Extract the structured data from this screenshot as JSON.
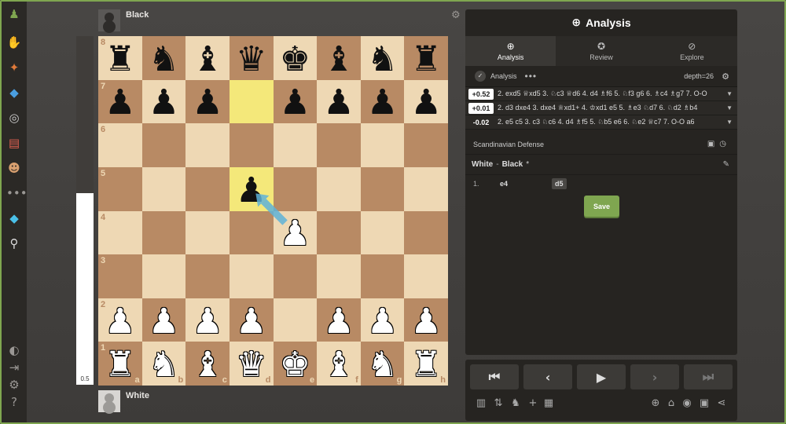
{
  "sidebar": {
    "icons": [
      "pawn-logo-icon",
      "play-icon",
      "puzzle-icon",
      "learn-icon",
      "watch-icon",
      "news-icon",
      "social-icon",
      "more-icon",
      "diamond-icon",
      "search-icon",
      "theme-icon",
      "login-icon",
      "settings-icon",
      "help-icon"
    ]
  },
  "players": {
    "top": {
      "name": "Black"
    },
    "bottom": {
      "name": "White"
    }
  },
  "eval_bar": {
    "text": "0.5",
    "white_fraction": 0.55
  },
  "board": {
    "light_color": "#eed8b4",
    "dark_color": "#b88a64",
    "highlight_color": "#f4e87a",
    "ranks": [
      "8",
      "7",
      "6",
      "5",
      "4",
      "3",
      "2",
      "1"
    ],
    "files": [
      "a",
      "b",
      "c",
      "d",
      "e",
      "f",
      "g",
      "h"
    ],
    "position": [
      [
        "br",
        "bn",
        "bb",
        "bq",
        "bk",
        "bb",
        "bn",
        "br"
      ],
      [
        "bp",
        "bp",
        "bp",
        "",
        "bp",
        "bp",
        "bp",
        "bp"
      ],
      [
        "",
        "",
        "",
        "",
        "",
        "",
        "",
        ""
      ],
      [
        "",
        "",
        "",
        "bp",
        "",
        "",
        "",
        ""
      ],
      [
        "",
        "",
        "",
        "",
        "wp",
        "",
        "",
        ""
      ],
      [
        "",
        "",
        "",
        "",
        "",
        "",
        "",
        ""
      ],
      [
        "wp",
        "wp",
        "wp",
        "wp",
        "",
        "wp",
        "wp",
        "wp"
      ],
      [
        "wr",
        "wn",
        "wb",
        "wq",
        "wk",
        "wb",
        "wn",
        "wr"
      ]
    ],
    "highlighted_squares": [
      "d7",
      "d5"
    ],
    "arrow": {
      "from": "e4",
      "to": "d5",
      "color": "#5fb3d8"
    }
  },
  "panel": {
    "title": "Analysis",
    "tabs": [
      {
        "label": "Analysis",
        "icon": "analysis-icon",
        "active": true
      },
      {
        "label": "Review",
        "icon": "star-icon",
        "active": false
      },
      {
        "label": "Explore",
        "icon": "compass-icon",
        "active": false
      }
    ],
    "analysis_toggle_label": "Analysis",
    "depth": "depth=26",
    "lines": [
      {
        "score": "+0.52",
        "side": "w",
        "moves": "2. exd5 ♕xd5 3. ♘c3 ♕d6 4. d4 ♗f6 5. ♘f3 g6 6. ♗c4 ♗g7 7. O-O"
      },
      {
        "score": "+0.01",
        "side": "w",
        "moves": "2. d3 dxe4 3. dxe4 ♕xd1+ 4. ♔xd1 e5 5. ♗e3 ♘d7 6. ♘d2 ♗b4"
      },
      {
        "score": "-0.02",
        "side": "b",
        "moves": "2. e5 c5 3. c3 ♘c6 4. d4 ♗f5 5. ♘b5 e6 6. ♘e2 ♕c7 7. O-O a6"
      }
    ],
    "opening": "Scandinavian Defense",
    "game_header": {
      "white": "White",
      "separator": "-",
      "black": "Black",
      "marker": "*"
    },
    "moves": [
      {
        "number": "1.",
        "white": "e4",
        "black": "d5"
      }
    ],
    "save_label": "Save"
  },
  "nav": {
    "first": "⏮",
    "prev": "‹",
    "play": "▶",
    "next": "›",
    "last": "⏭"
  },
  "icons": {
    "accent": "#7fa650"
  }
}
